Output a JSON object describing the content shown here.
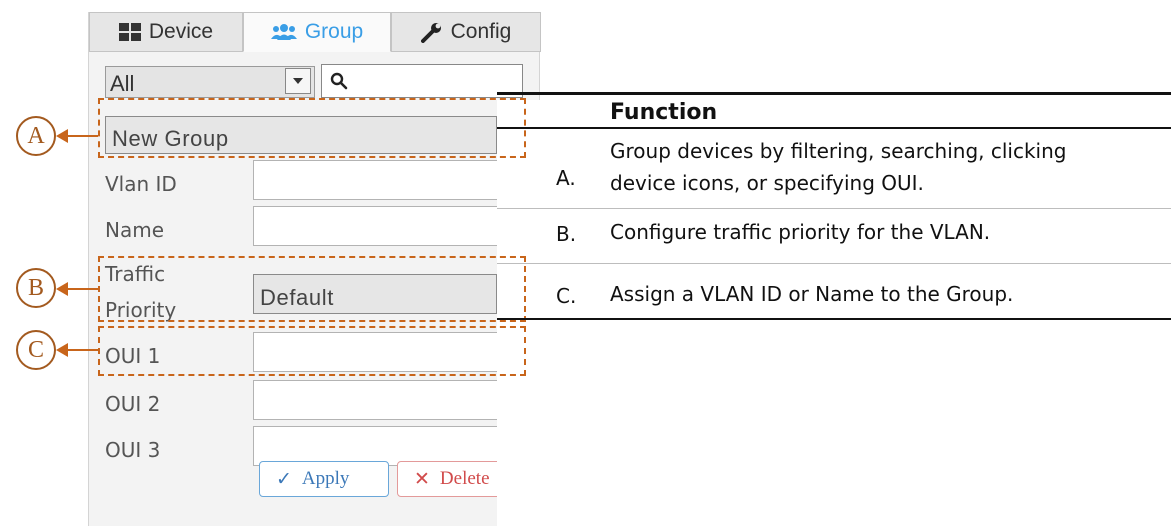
{
  "tabs": [
    {
      "label": "Device",
      "icon": "grid-icon"
    },
    {
      "label": "Group",
      "icon": "users-icon"
    },
    {
      "label": "Config",
      "icon": "wrench-icon"
    }
  ],
  "filter": {
    "value": "All"
  },
  "group": {
    "value": "New Group"
  },
  "form": {
    "vlan_label": "Vlan ID",
    "name_label": "Name",
    "traffic_label_1": "Traffic",
    "traffic_label_2": "Priority",
    "traffic_value": "Default",
    "oui1_label": "OUI 1",
    "oui2_label": "OUI 2",
    "oui3_label": "OUI 3"
  },
  "buttons": {
    "apply": "Apply",
    "delete": "Delete"
  },
  "callouts": [
    "A",
    "B",
    "C"
  ],
  "table": {
    "header": "Function",
    "rows": [
      {
        "letter": "A.",
        "line1": "Group devices by filtering, searching, clicking",
        "line2": "device icons, or specifying OUI."
      },
      {
        "letter": "B.",
        "line1": "Configure traffic priority for the VLAN.",
        "line2": ""
      },
      {
        "letter": "C.",
        "line1": "Assign a VLAN ID or Name to the Group.",
        "line2": ""
      }
    ]
  },
  "colors": {
    "accent": "#3a9ee6",
    "callout": "#c8651b"
  }
}
